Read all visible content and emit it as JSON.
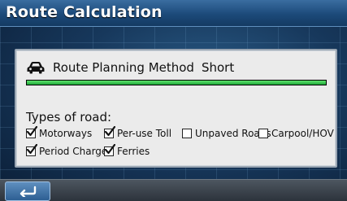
{
  "header": {
    "title": "Route Calculation"
  },
  "route": {
    "planning_label": "Route Planning Method",
    "planning_value": "Short",
    "progress_percent": 100,
    "progress_color": "#2fc24b"
  },
  "road_types": {
    "heading": "Types of road:",
    "options": [
      {
        "label": "Motorways",
        "checked": true
      },
      {
        "label": "Per-use Toll",
        "checked": true
      },
      {
        "label": "Unpaved Roads",
        "checked": false
      },
      {
        "label": "Carpool/HOV",
        "checked": false
      },
      {
        "label": "Period Charge",
        "checked": true
      },
      {
        "label": "Ferries",
        "checked": true
      }
    ]
  },
  "footer": {
    "back_icon": "back-arrow-icon"
  }
}
